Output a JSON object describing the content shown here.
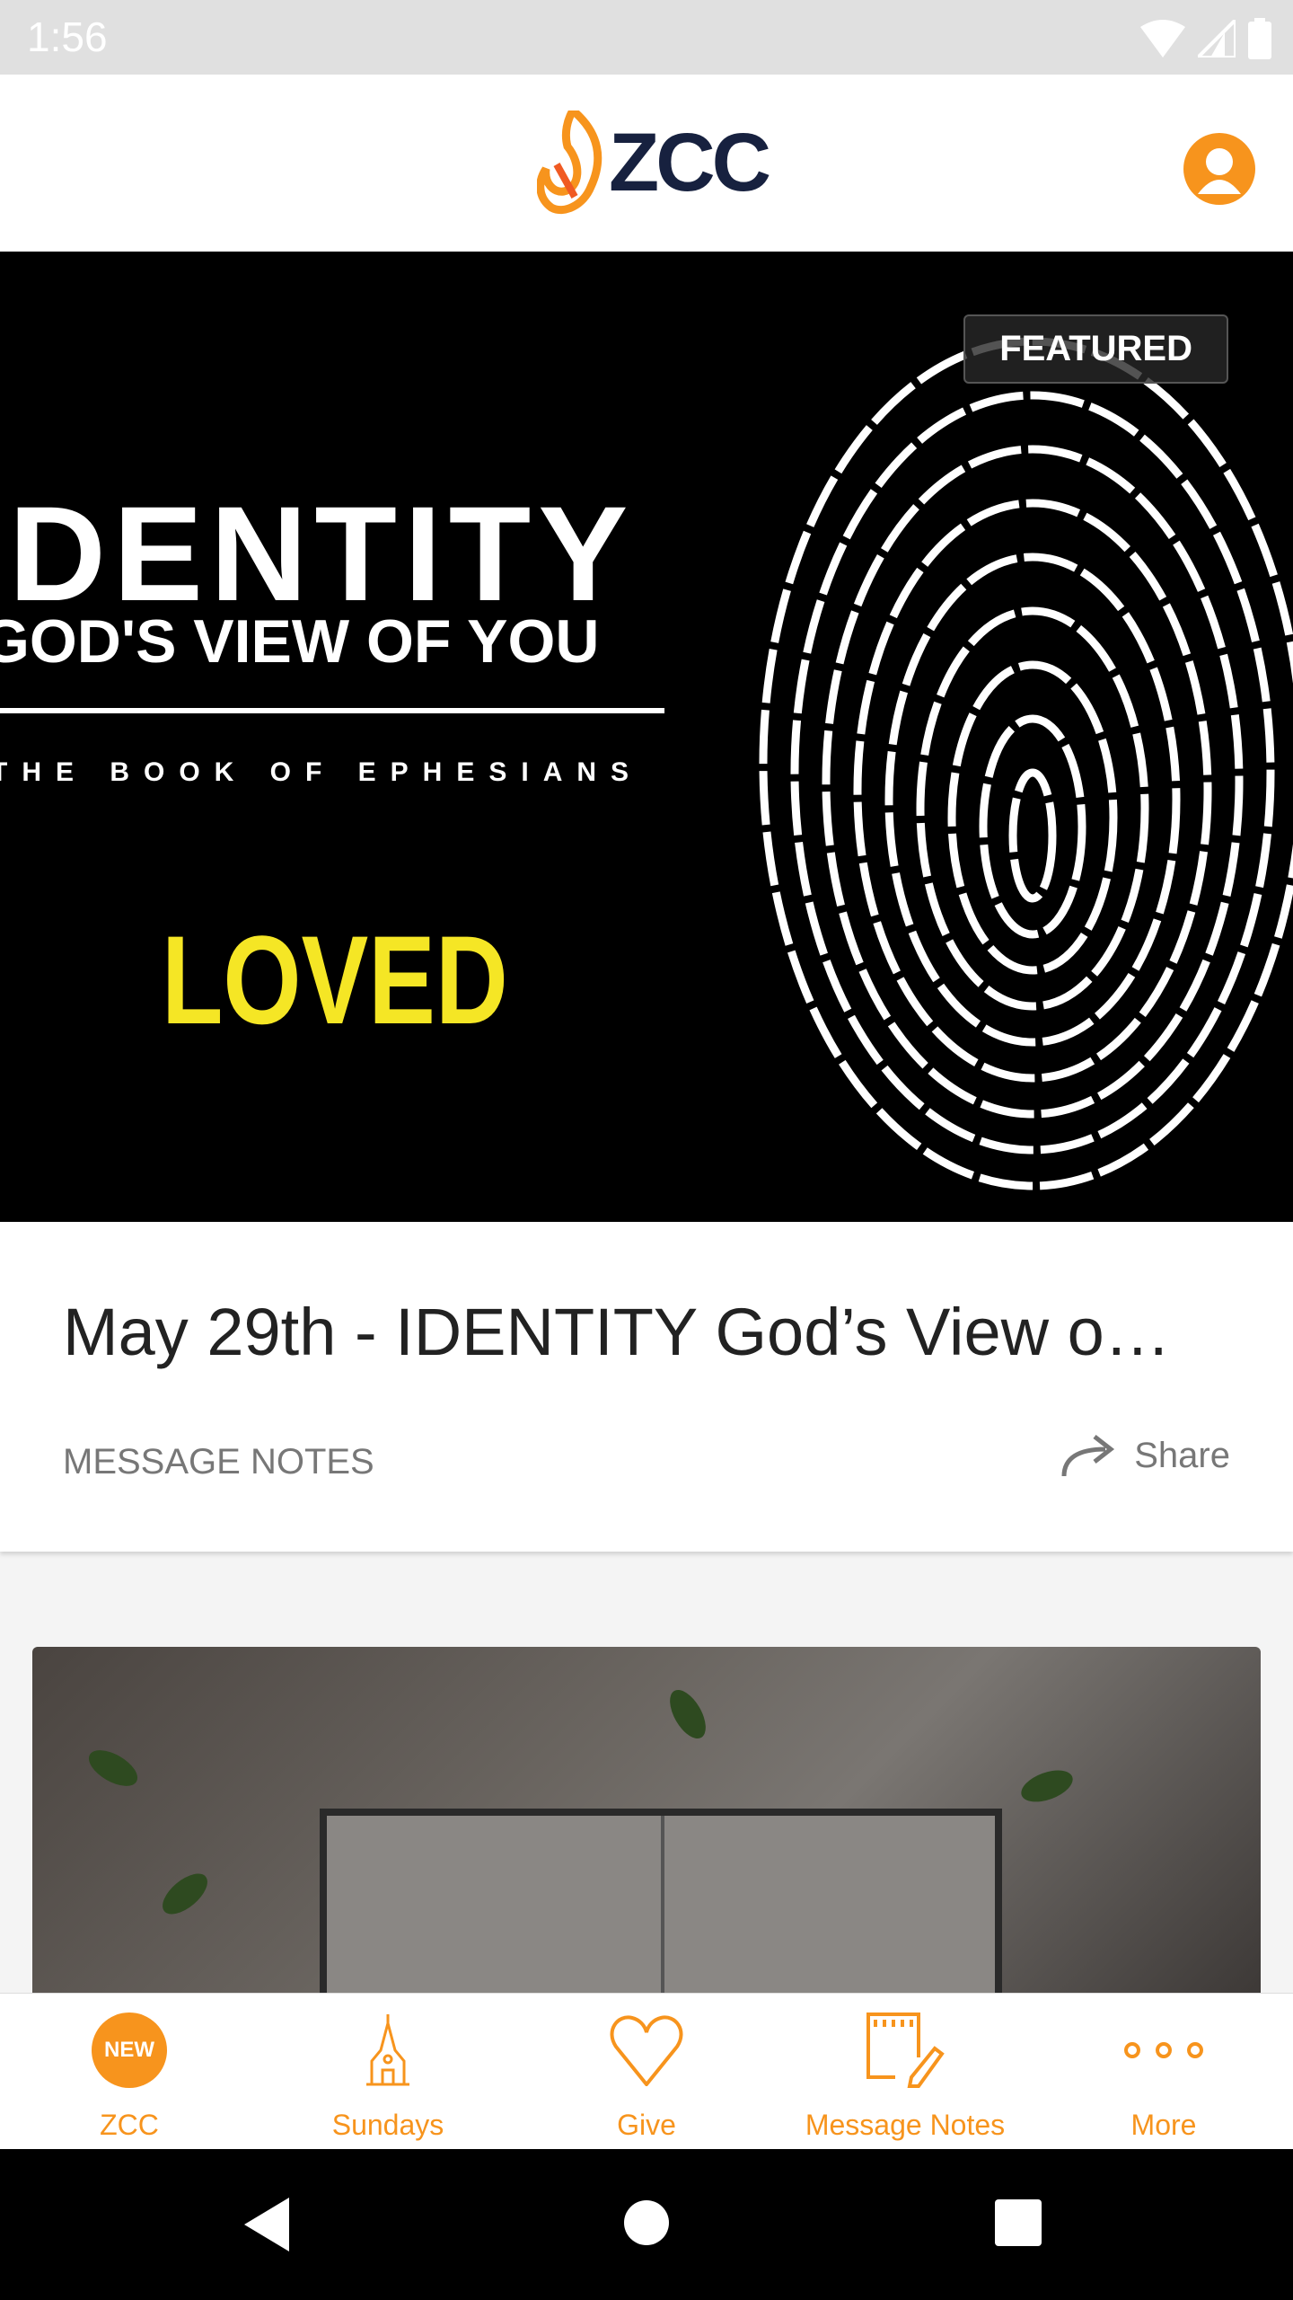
{
  "status_bar": {
    "time": "1:56"
  },
  "header": {
    "logo_text": "ZCC",
    "accent": "#f7941d",
    "brand_dark": "#17213f"
  },
  "featured": {
    "badge": "FEATURED",
    "art": {
      "line1": "IDENTITY",
      "line2": "GOD'S VIEW OF YOU",
      "line3": "THE BOOK OF EPHESIANS",
      "line4": "LOVED"
    },
    "title": "May 29th - IDENTITY  God’s View o…",
    "category": "MESSAGE NOTES",
    "share_label": "Share"
  },
  "bottom_nav": {
    "items": [
      {
        "label": "ZCC",
        "icon": "new-badge-icon",
        "badge": "NEW"
      },
      {
        "label": "Sundays",
        "icon": "church-icon"
      },
      {
        "label": "Give",
        "icon": "heart-icon"
      },
      {
        "label": "Message Notes",
        "icon": "notepad-pencil-icon"
      },
      {
        "label": "More",
        "icon": "more-dots-icon"
      }
    ]
  }
}
